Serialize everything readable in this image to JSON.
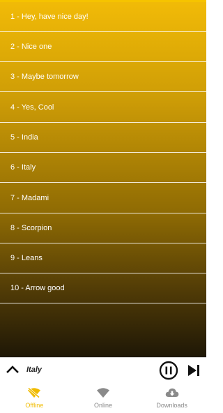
{
  "playlist": {
    "tracks": [
      {
        "label": "1 - Hey, have nice day!"
      },
      {
        "label": "2 - Nice one"
      },
      {
        "label": "3 - Maybe tomorrow"
      },
      {
        "label": "4 - Yes, Cool"
      },
      {
        "label": "5 - India"
      },
      {
        "label": "6 - Italy"
      },
      {
        "label": "7 - Madami"
      },
      {
        "label": "8 - Scorpion"
      },
      {
        "label": "9 - Leans"
      },
      {
        "label": "10 - Arrow good"
      }
    ]
  },
  "player": {
    "now_playing": "Italy",
    "icons": {
      "expand": "chevron-up-icon",
      "pause": "pause-circle-icon",
      "next": "skip-next-icon"
    }
  },
  "bottom_nav": {
    "items": [
      {
        "label": "Offline",
        "icon": "wifi-off-icon",
        "active": true
      },
      {
        "label": "Online",
        "icon": "wifi-icon",
        "active": false
      },
      {
        "label": "Downloads",
        "icon": "cloud-download-icon",
        "active": false
      }
    ]
  },
  "colors": {
    "accent": "#f0bb00",
    "inactive": "#8a8a8a",
    "gradient_top": "#f2bb07",
    "gradient_bottom": "#1e1706"
  }
}
